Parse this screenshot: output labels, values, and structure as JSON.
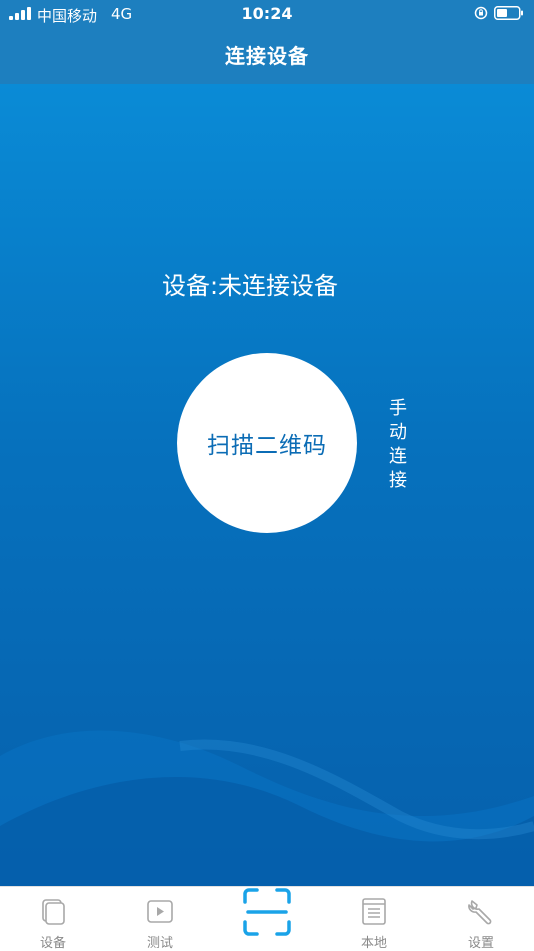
{
  "status_bar": {
    "carrier": "中国移动",
    "network": "4G",
    "time": "10:24"
  },
  "nav": {
    "title": "连接设备"
  },
  "main": {
    "device_status": "设备:未连接设备",
    "scan_button_label": "扫描二维码",
    "manual_connect_label": "手动连接"
  },
  "tabbar": {
    "tabs": [
      {
        "label": "设备",
        "icon": "device-icon"
      },
      {
        "label": "测试",
        "icon": "play-icon"
      },
      {
        "label": "",
        "icon": "scan-qr-icon"
      },
      {
        "label": "本地",
        "icon": "document-icon"
      },
      {
        "label": "设置",
        "icon": "wrench-icon"
      }
    ]
  },
  "colors": {
    "nav_bar": "#1d7fbf",
    "main_top": "#0a8bd6",
    "main_bottom": "#0660ac",
    "accent": "#1aa3e8",
    "scan_text": "#0b6cb5",
    "tab_inactive": "#8a8a8a"
  }
}
